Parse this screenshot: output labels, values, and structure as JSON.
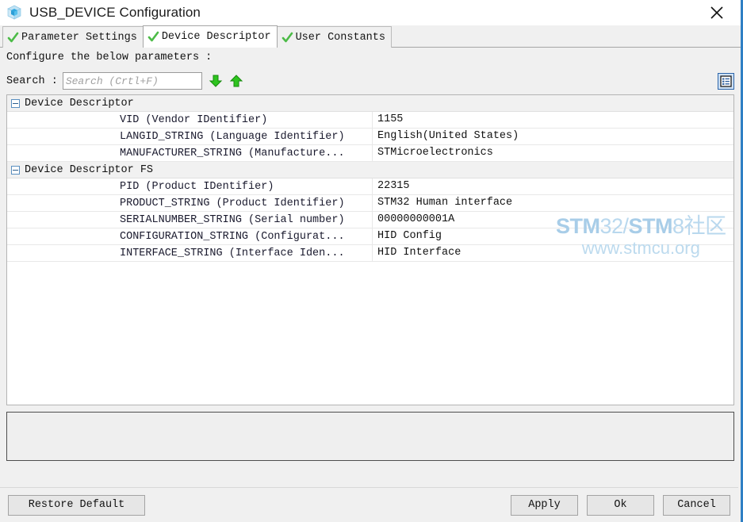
{
  "window": {
    "title": "USB_DEVICE Configuration",
    "icon": "cube-icon",
    "close_label": "✕"
  },
  "tabs": [
    {
      "label": "Parameter Settings",
      "active": false,
      "icon": "check-icon"
    },
    {
      "label": "Device Descriptor",
      "active": true,
      "icon": "check-icon"
    },
    {
      "label": "User Constants",
      "active": false,
      "icon": "check-icon"
    }
  ],
  "instruction": "Configure the below parameters :",
  "search": {
    "label": "Search :",
    "value": "",
    "placeholder": "Search (Crtl+F)",
    "next_icon": "arrow-down-icon",
    "prev_icon": "arrow-up-icon",
    "toggle_icon": "list-view-icon"
  },
  "tree": {
    "rows": [
      {
        "type": "group",
        "label": "Device Descriptor",
        "value": "",
        "expanded": true
      },
      {
        "type": "leaf",
        "label": "VID (Vendor IDentifier)",
        "value": "1155"
      },
      {
        "type": "leaf",
        "label": "LANGID_STRING (Language Identifier)",
        "value": "English(United States)"
      },
      {
        "type": "leaf",
        "label": "MANUFACTURER_STRING (Manufacture...",
        "value": "STMicroelectronics"
      },
      {
        "type": "group",
        "label": "Device Descriptor FS",
        "value": "",
        "expanded": true
      },
      {
        "type": "leaf",
        "label": "PID (Product IDentifier)",
        "value": "22315"
      },
      {
        "type": "leaf",
        "label": "PRODUCT_STRING (Product Identifier)",
        "value": "STM32 Human interface"
      },
      {
        "type": "leaf",
        "label": "SERIALNUMBER_STRING (Serial number)",
        "value": "00000000001A"
      },
      {
        "type": "leaf",
        "label": "CONFIGURATION_STRING (Configurat...",
        "value": "HID Config"
      },
      {
        "type": "leaf",
        "label": "INTERFACE_STRING (Interface Iden...",
        "value": "HID Interface"
      }
    ]
  },
  "watermark": {
    "line1_bold1": "STM",
    "line1_light1": "32/",
    "line1_bold2": "STM",
    "line1_light2": "8社区",
    "line2": "www.stmcu.org"
  },
  "description_panel": {
    "text": ""
  },
  "footer": {
    "restore": "Restore Default",
    "apply": "Apply",
    "ok": "Ok",
    "cancel": "Cancel"
  },
  "colors": {
    "accent": "#2f7fc4",
    "check": "#4cbb47",
    "arrow": "#2ec41f",
    "window_bg": "#f0f0f0",
    "watermark": "#a8cde8"
  }
}
